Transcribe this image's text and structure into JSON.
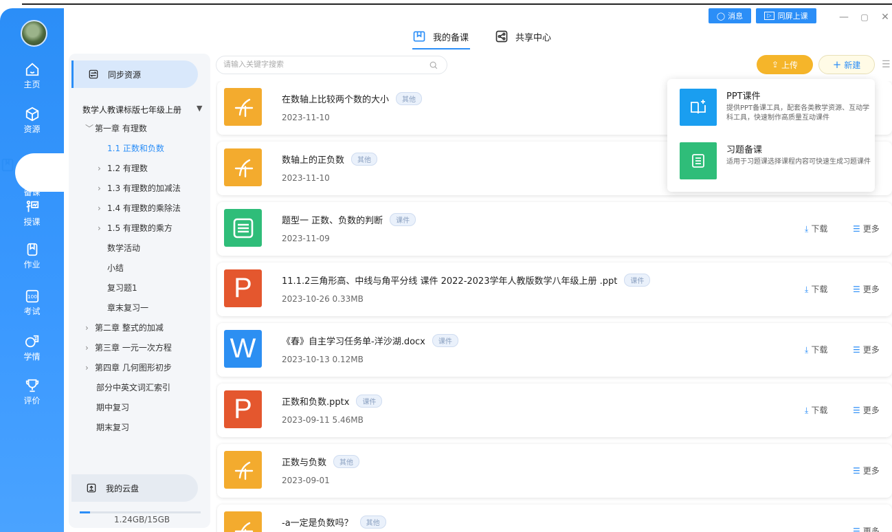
{
  "header": {
    "tabs": [
      {
        "label": "我的备课",
        "icon": "book-open-icon",
        "active": true
      },
      {
        "label": "共享中心",
        "icon": "share-icon",
        "active": false
      }
    ],
    "message_label": "消息",
    "screen_label": "同屏上课"
  },
  "nav": {
    "items": [
      {
        "label": "主页",
        "icon": "home-icon"
      },
      {
        "label": "资源",
        "icon": "box-icon"
      },
      {
        "label": "备课",
        "icon": "book-icon",
        "active": true
      },
      {
        "label": "授课",
        "icon": "teaching-icon"
      },
      {
        "label": "作业",
        "icon": "homework-icon"
      },
      {
        "label": "考试",
        "icon": "exam-icon"
      },
      {
        "label": "学情",
        "icon": "analytics-icon"
      },
      {
        "label": "评价",
        "icon": "trophy-icon"
      }
    ]
  },
  "tree": {
    "sync_label": "同步资源",
    "book_title": "数学人教课标版七年级上册",
    "rows": [
      {
        "label": "第一章 有理数",
        "caret": "﹀",
        "indent": 1
      },
      {
        "label": "1.1 正数和负数",
        "caret": "",
        "indent": 2,
        "selected": true
      },
      {
        "label": "1.2 有理数",
        "caret": "›",
        "indent": 2
      },
      {
        "label": "1.3 有理数的加减法",
        "caret": "›",
        "indent": 2
      },
      {
        "label": "1.4 有理数的乘除法",
        "caret": "›",
        "indent": 2
      },
      {
        "label": "1.5 有理数的乘方",
        "caret": "›",
        "indent": 2
      },
      {
        "label": "数学活动",
        "caret": "",
        "indent": 3
      },
      {
        "label": "小结",
        "caret": "",
        "indent": 3
      },
      {
        "label": "复习题1",
        "caret": "",
        "indent": 3
      },
      {
        "label": "章末复习一",
        "caret": "",
        "indent": 3
      },
      {
        "label": "第二章 整式的加减",
        "caret": "›",
        "indent": 1
      },
      {
        "label": "第三章 一元一次方程",
        "caret": "›",
        "indent": 1
      },
      {
        "label": "第四章 几何图形初步",
        "caret": "›",
        "indent": 1
      },
      {
        "label": "部分中英文词汇索引",
        "caret": "",
        "indent": 0
      },
      {
        "label": "期中复习",
        "caret": "",
        "indent": 0
      },
      {
        "label": "期末复习",
        "caret": "",
        "indent": 0
      }
    ],
    "cloud_label": "我的云盘",
    "quota_text": "1.24GB/15GB",
    "quota_fraction": 0.083
  },
  "search": {
    "placeholder": "请输入关键字搜索"
  },
  "actions": {
    "upload_label": "上传",
    "new_label": "新建"
  },
  "popup": {
    "items": [
      {
        "title": "PPT课件",
        "desc": "提供PPT备课工具，配套各类教学资源、互动学科工具，快速制作高质量互动课件",
        "color": "#1a9ef0"
      },
      {
        "title": "习题备课",
        "desc": "适用于习题课选择课程内容可快速生成习题课件",
        "color": "#2fbd79"
      }
    ]
  },
  "list": {
    "download_label": "下载",
    "more_label": "更多",
    "items": [
      {
        "title": "在数轴上比较两个数的大小",
        "tag": "其他",
        "meta": "2023-11-10",
        "thumb": "other",
        "download": false
      },
      {
        "title": "数轴上的正负数",
        "tag": "其他",
        "meta": "2023-11-10",
        "thumb": "other",
        "download": false
      },
      {
        "title": "题型一 正数、负数的判断",
        "tag": "课件",
        "meta": "2023-11-09",
        "thumb": "quiz",
        "download": true
      },
      {
        "title": "11.1.2三角形高、中线与角平分线 课件   2022-2023学年人教版数学八年级上册 .ppt",
        "tag": "课件",
        "meta": "2023-10-26  0.33MB",
        "thumb": "ppt",
        "download": true
      },
      {
        "title": "《春》自主学习任务单-洋沙湖.docx",
        "tag": "课件",
        "meta": "2023-10-13  0.12MB",
        "thumb": "word",
        "download": true
      },
      {
        "title": "正数和负数.pptx",
        "tag": "课件",
        "meta": "2023-09-11  5.46MB",
        "thumb": "ppt",
        "download": true
      },
      {
        "title": "正数与负数",
        "tag": "其他",
        "meta": "2023-09-01",
        "thumb": "other",
        "download": false
      },
      {
        "title": "-a一定是负数吗？",
        "tag": "其他",
        "meta": "",
        "thumb": "other",
        "download": false
      }
    ]
  }
}
